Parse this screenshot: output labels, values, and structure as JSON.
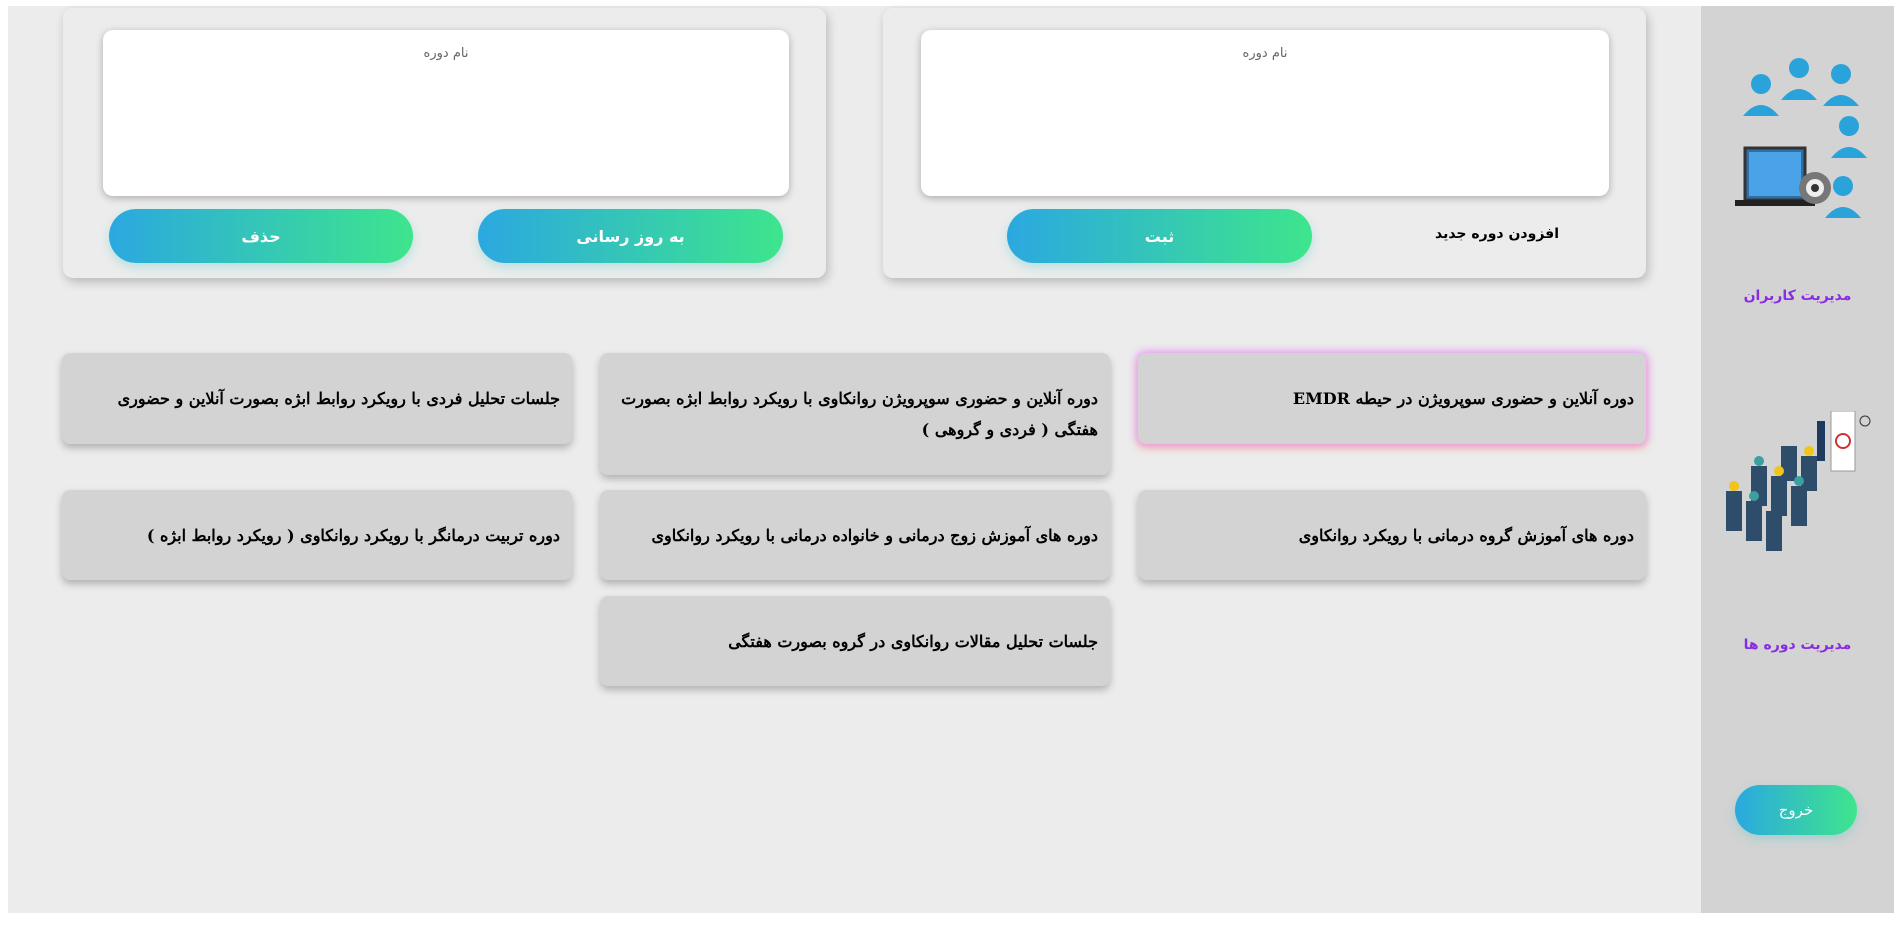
{
  "sidebar": {
    "users_link": "مدیریت کاربران",
    "courses_link": "مدیریت دوره ها",
    "logout": "خروج",
    "users_icon": "users-computer-illustration",
    "courses_icon": "classroom-presentation-illustration"
  },
  "add_form": {
    "title": "افزودن دوره جدید",
    "placeholder": "نام دوره",
    "submit": "ثبت"
  },
  "edit_form": {
    "placeholder": "نام دوره",
    "update": "به روز رسانی",
    "delete": "حذف"
  },
  "courses": [
    "دوره آنلاین و حضوری سوپرویژن در حیطه EMDR",
    "دوره آنلاین و حضوری سوپرویژن روانکاوی با رویکرد روابط ابژه بصورت هفتگی ( فردی و گروهی )",
    "جلسات تحلیل فردی با رویکرد روابط ابژه بصورت آنلاین و حضوری",
    "دوره های آموزش گروه درمانی با رویکرد روانکاوی",
    "دوره های آموزش زوج درمانی و خانواده درمانی با رویکرد روانکاوی",
    "دوره تربیت درمانگر با رویکرد روانکاوی ( رویکرد روابط ابژه )",
    "جلسات تحلیل مقالات روانکاوی در گروه بصورت هفتگی"
  ],
  "colors": {
    "accent_link": "#8a2be2",
    "gradient_start": "#2ba8e0",
    "gradient_end": "#3ee58c"
  }
}
